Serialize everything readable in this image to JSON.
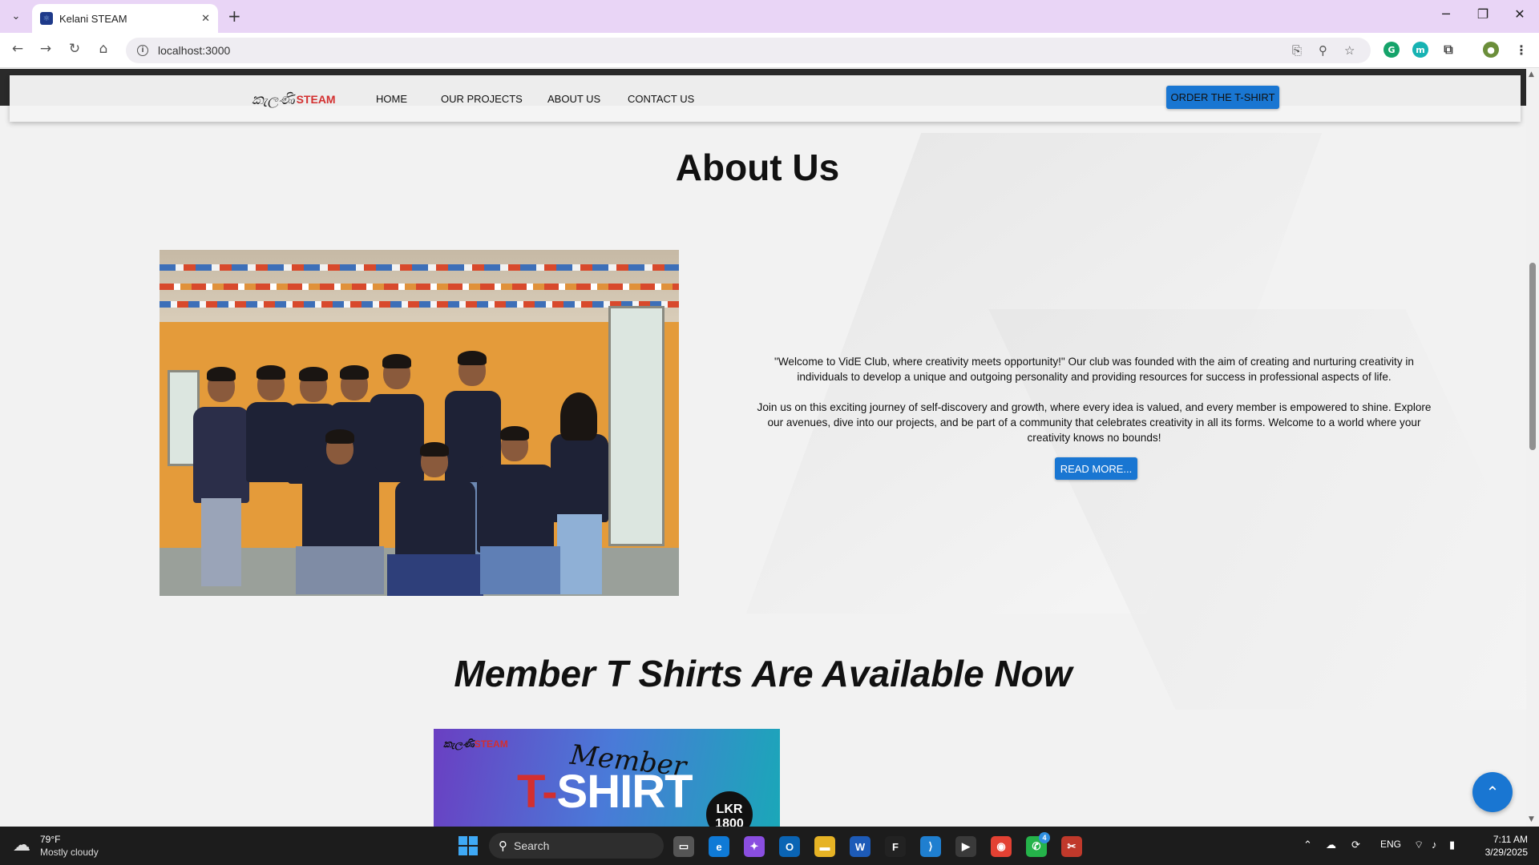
{
  "browser": {
    "tab_title": "Kelani STEAM",
    "url": "localhost:3000",
    "new_tab_label": "+",
    "tab_close_label": "✕"
  },
  "site": {
    "logo_text": "STEAM",
    "logo_script": "කැලණි",
    "nav": [
      {
        "label": "HOME"
      },
      {
        "label": "OUR PROJECTS"
      },
      {
        "label": "ABOUT US"
      },
      {
        "label": "CONTACT US"
      }
    ],
    "order_button": "ORDER THE T-SHIRT"
  },
  "about": {
    "heading": "About Us",
    "paragraph_1": "\"Welcome to VidE Club, where creativity meets opportunity!\" Our club was founded with the aim of creating and nurturing creativity in individuals to develop a unique and outgoing personality and providing resources for success in professional aspects of life.",
    "paragraph_2": "Join us on this exciting journey of self-discovery and growth, where every idea is valued, and every member is empowered to shine. Explore our avenues, dive into our projects, and be part of a community that celebrates creativity in all its forms. Welcome to a world where your creativity knows no bounds!",
    "read_more": "READ MORE..."
  },
  "tshirt": {
    "heading": "Member T Shirts Are Available Now",
    "banner_member": "Member",
    "banner_t": "T-",
    "banner_shirt": "SHIRT",
    "banner_price": "LKR 1800",
    "banner_logo": "STEAM"
  },
  "taskbar": {
    "weather_temp": "79°F",
    "weather_desc": "Mostly cloudy",
    "search_label": "Search",
    "lang": "ENG",
    "time": "7:11 AM",
    "date": "3/29/2025",
    "whatsapp_badge": "4"
  },
  "colors": {
    "accent_blue": "#1976d2",
    "tab_bar": "#e9d5f6",
    "logo_red": "#d32f2f"
  }
}
